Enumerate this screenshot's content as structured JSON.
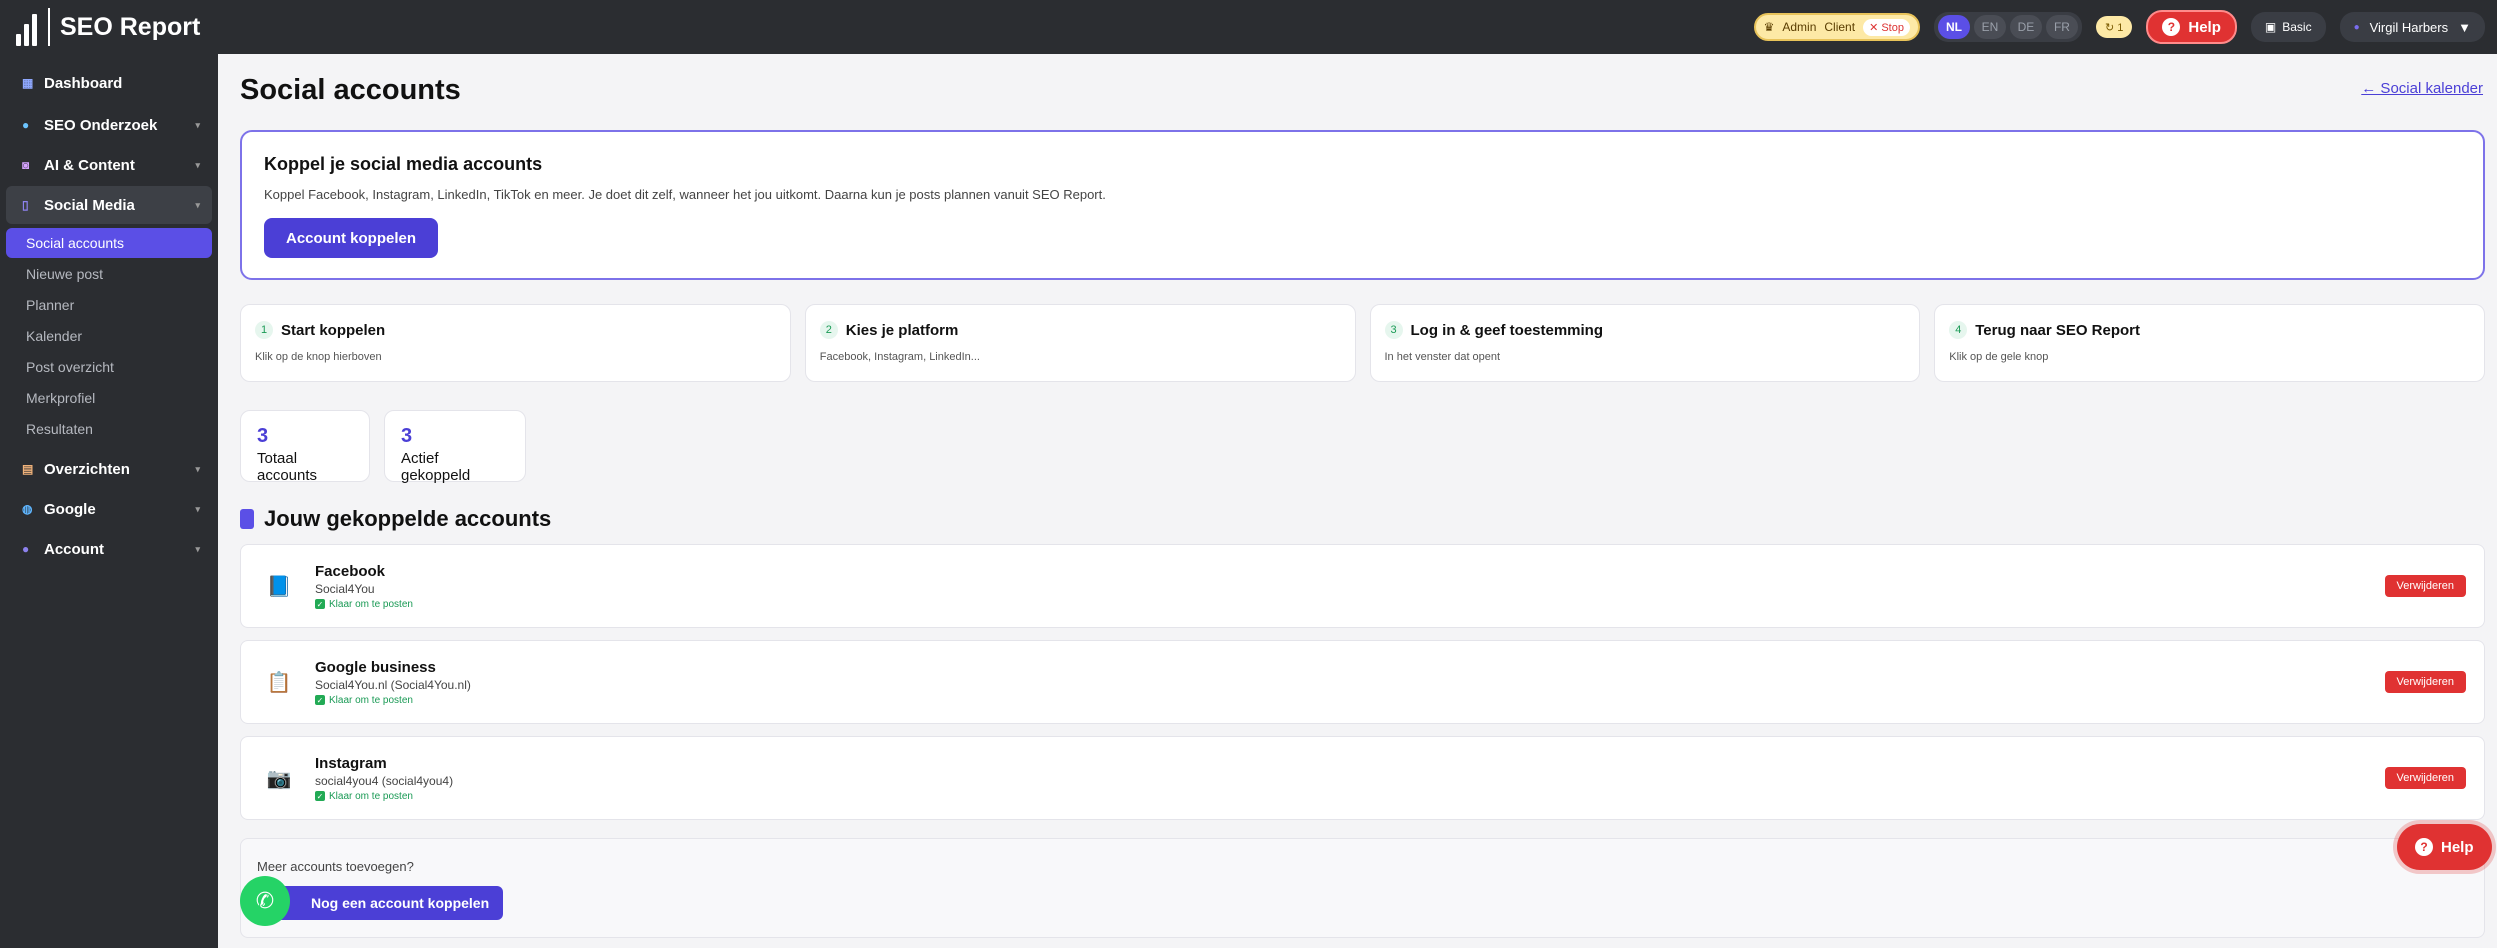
{
  "app": {
    "title": "SEO Report"
  },
  "topbar": {
    "role_label": "Admin",
    "role_sub": "Client",
    "role_stop": "✕ Stop",
    "languages": [
      "NL",
      "EN",
      "DE",
      "FR"
    ],
    "active_language": "NL",
    "credits": "↻ 1",
    "help_label": "Help",
    "plan_label": "Basic",
    "user_name": "Virgil Harbers"
  },
  "sidebar": {
    "items": [
      {
        "label": "Dashboard",
        "icon": "dashboard-icon"
      },
      {
        "label": "SEO Onderzoek",
        "icon": "search-icon"
      },
      {
        "label": "AI & Content",
        "icon": "robot-icon"
      },
      {
        "label": "Social Media",
        "icon": "phone-icon"
      },
      {
        "label": "Overzichten",
        "icon": "clipboard-icon"
      },
      {
        "label": "Google",
        "icon": "globe-icon"
      },
      {
        "label": "Account",
        "icon": "user-icon"
      }
    ],
    "social_sub": [
      "Social accounts",
      "Nieuwe post",
      "Planner",
      "Kalender",
      "Post overzicht",
      "Merkprofiel",
      "Resultaten"
    ]
  },
  "page": {
    "title": "Social accounts",
    "back_link": "← Social kalender"
  },
  "intro": {
    "title": "Koppel je social media accounts",
    "text": "Koppel Facebook, Instagram, LinkedIn, TikTok en meer. Je doet dit zelf, wanneer het jou uitkomt. Daarna kun je posts plannen vanuit SEO Report.",
    "button": "Account koppelen"
  },
  "steps": [
    {
      "num": "1",
      "title": "Start koppelen",
      "desc": "Klik op de knop hierboven"
    },
    {
      "num": "2",
      "title": "Kies je platform",
      "desc": "Facebook, Instagram, LinkedIn..."
    },
    {
      "num": "3",
      "title": "Log in & geef toestemming",
      "desc": "In het venster dat opent"
    },
    {
      "num": "4",
      "title": "Terug naar SEO Report",
      "desc": "Klik op de gele knop"
    }
  ],
  "stats": [
    {
      "value": "3",
      "label": "Totaal accounts"
    },
    {
      "value": "3",
      "label": "Actief gekoppeld"
    }
  ],
  "accounts_section": {
    "title": "Jouw gekoppelde accounts"
  },
  "accounts": [
    {
      "icon": "book-icon",
      "glyph": "📘",
      "name": "Facebook",
      "handle": "Social4You",
      "status": "Klaar om te posten",
      "action": "Verwijderen"
    },
    {
      "icon": "clipboard-icon",
      "glyph": "📋",
      "name": "Google business",
      "handle": "Social4You.nl (Social4You.nl)",
      "status": "Klaar om te posten",
      "action": "Verwijderen"
    },
    {
      "icon": "camera-icon",
      "glyph": "📷",
      "name": "Instagram",
      "handle": "social4you4 (social4you4)",
      "status": "Klaar om te posten",
      "action": "Verwijderen"
    }
  ],
  "more": {
    "label": "Meer accounts toevoegen?",
    "button": "Nog een account koppelen"
  },
  "floating": {
    "help_label": "Help"
  }
}
